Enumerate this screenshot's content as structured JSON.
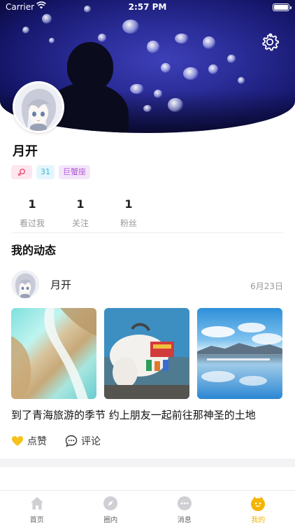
{
  "status_bar": {
    "carrier": "Carrier",
    "time": "2:57 PM"
  },
  "profile": {
    "username": "月开",
    "tags": {
      "gender_icon": "female-icon",
      "age": "31",
      "zodiac": "巨蟹座"
    },
    "stats": [
      {
        "value": "1",
        "label": "看过我"
      },
      {
        "value": "1",
        "label": "关注"
      },
      {
        "value": "1",
        "label": "粉丝"
      }
    ]
  },
  "section": {
    "title": "我的动态"
  },
  "post": {
    "author": "月开",
    "date": "6月23日",
    "text": "到了青海旅游的季节 约上朋友一起前往那神圣的土地",
    "actions": {
      "like_label": "点赞",
      "comment_label": "评论"
    }
  },
  "tabbar": {
    "items": [
      {
        "label": "首页",
        "icon": "home-icon"
      },
      {
        "label": "圈内",
        "icon": "compass-icon"
      },
      {
        "label": "消息",
        "icon": "chat-icon"
      },
      {
        "label": "我的",
        "icon": "profile-face-icon"
      }
    ],
    "active_color": "#f5b400"
  },
  "colors": {
    "accent": "#f5b400",
    "gender_tag": "#f0557a",
    "age_tag": "#38b6d6",
    "zodiac_tag": "#b35ad6"
  }
}
